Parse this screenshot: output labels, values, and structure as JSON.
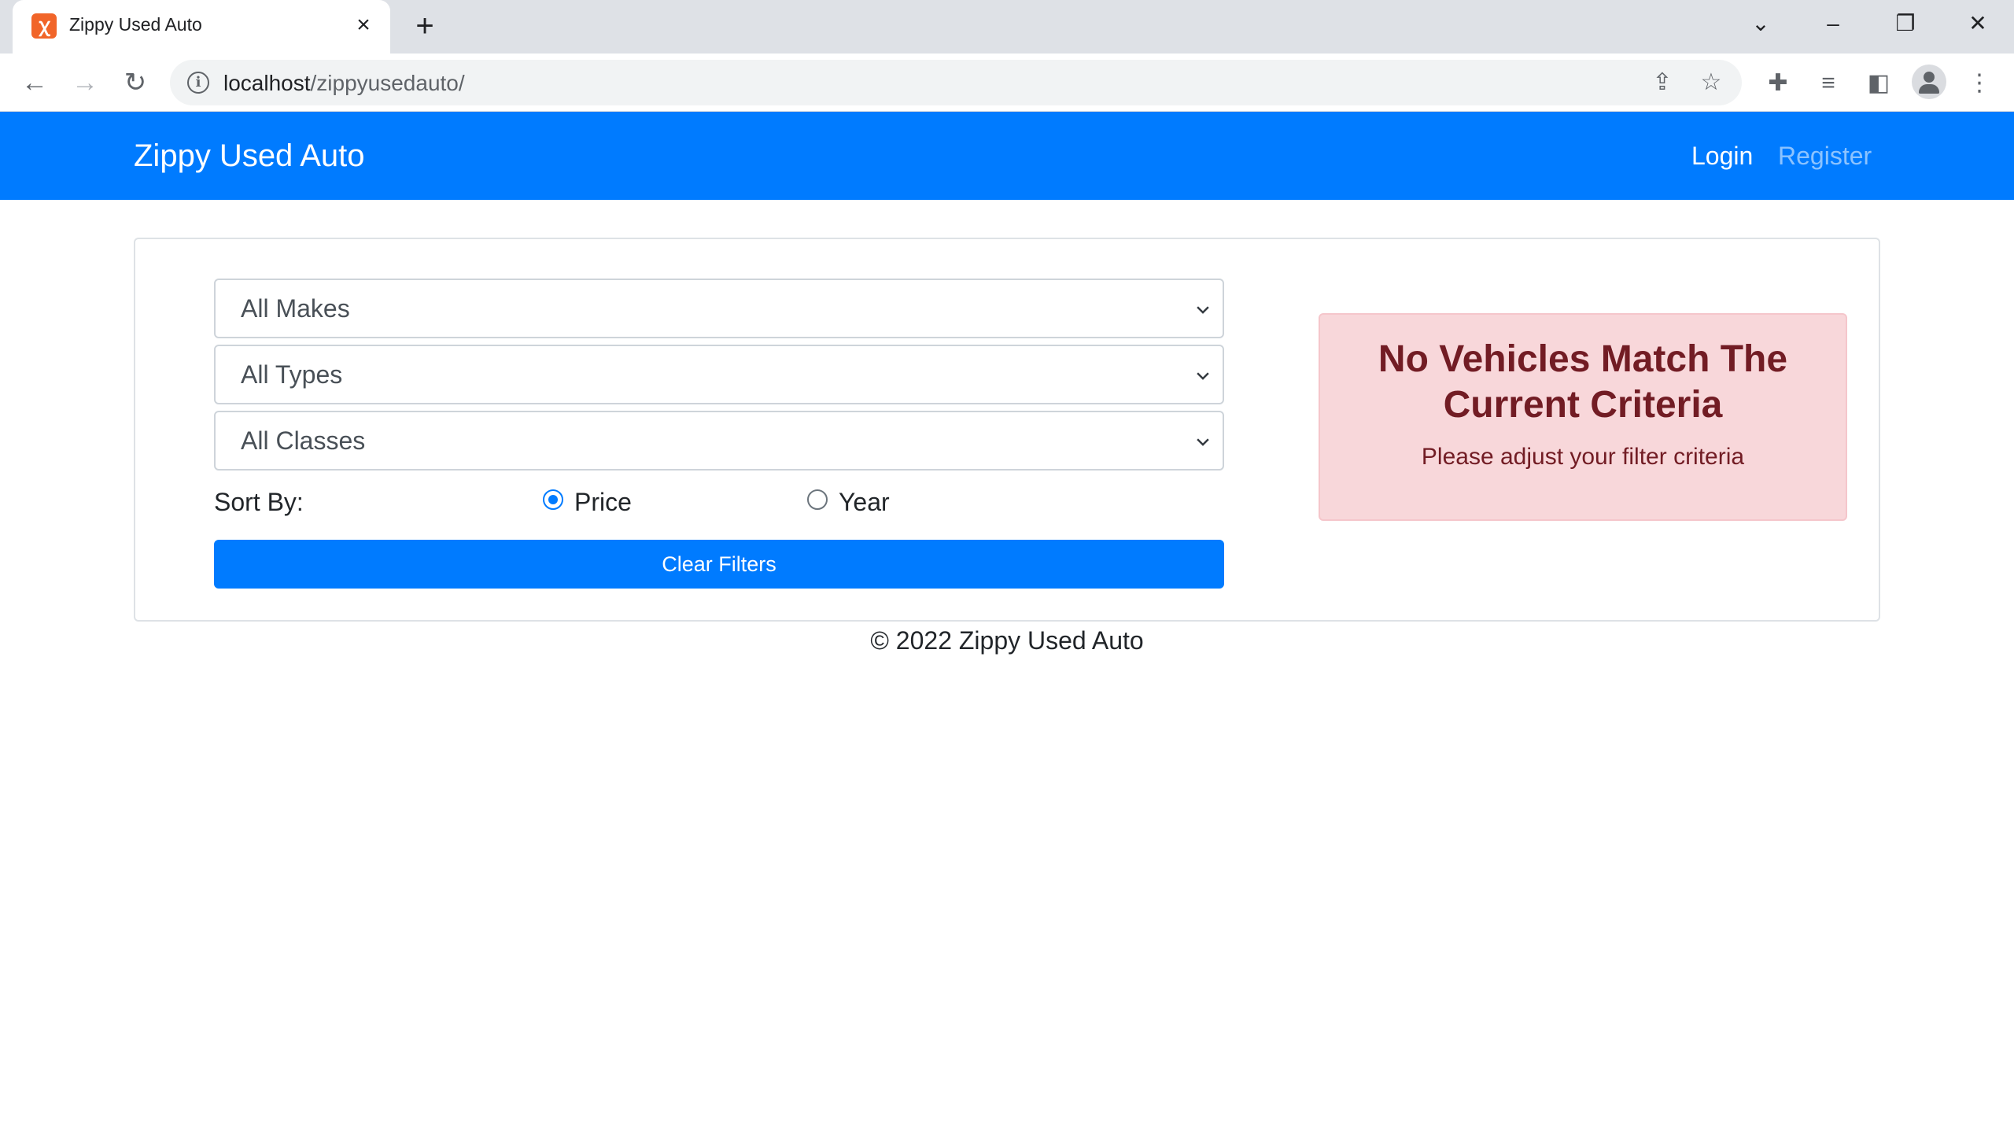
{
  "browser": {
    "tab_title": "Zippy Used Auto",
    "favicon_icon": "xampp-icon",
    "url_host": "localhost",
    "url_path": "/zippyusedauto/"
  },
  "navbar": {
    "brand": "Zippy Used Auto",
    "login": "Login",
    "register": "Register",
    "bg_color": "#007bff"
  },
  "filters": {
    "make_selected": "All Makes",
    "type_selected": "All Types",
    "class_selected": "All Classes",
    "sort_label": "Sort By:",
    "sort_options": [
      {
        "label": "Price",
        "checked": true
      },
      {
        "label": "Year",
        "checked": false
      }
    ],
    "clear_button": "Clear Filters"
  },
  "alert": {
    "heading_line1": "No Vehicles Match The",
    "heading_line2": "Current Criteria",
    "text": "Please adjust your filter criteria"
  },
  "footer": {
    "text": "© 2022 Zippy Used Auto"
  }
}
